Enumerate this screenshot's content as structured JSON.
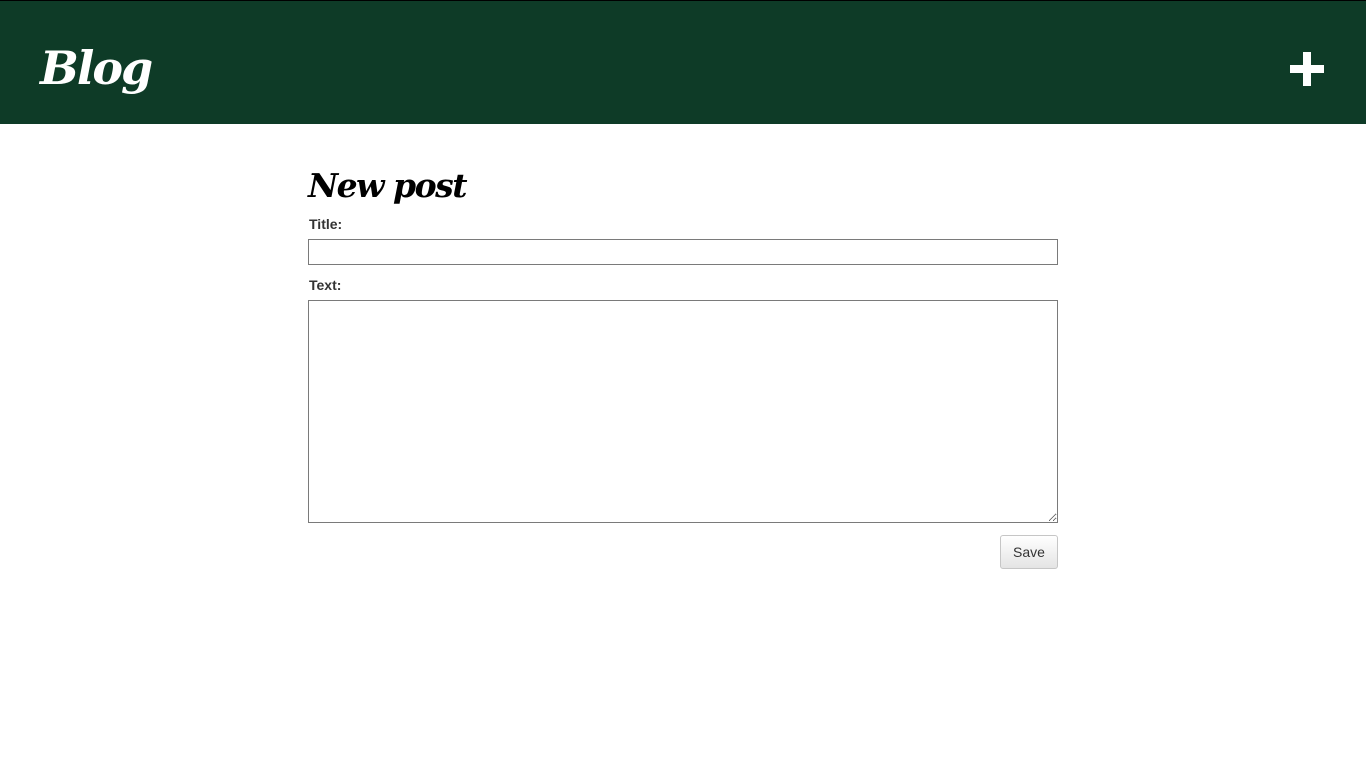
{
  "header": {
    "title": "Blog",
    "add_icon": "plus-icon"
  },
  "page": {
    "title": "New post"
  },
  "form": {
    "title_label": "Title:",
    "title_value": "",
    "text_label": "Text:",
    "text_value": "",
    "save_label": "Save"
  },
  "colors": {
    "header_background": "#0e3b27",
    "header_text": "#ffffff",
    "page_background": "#ffffff"
  }
}
